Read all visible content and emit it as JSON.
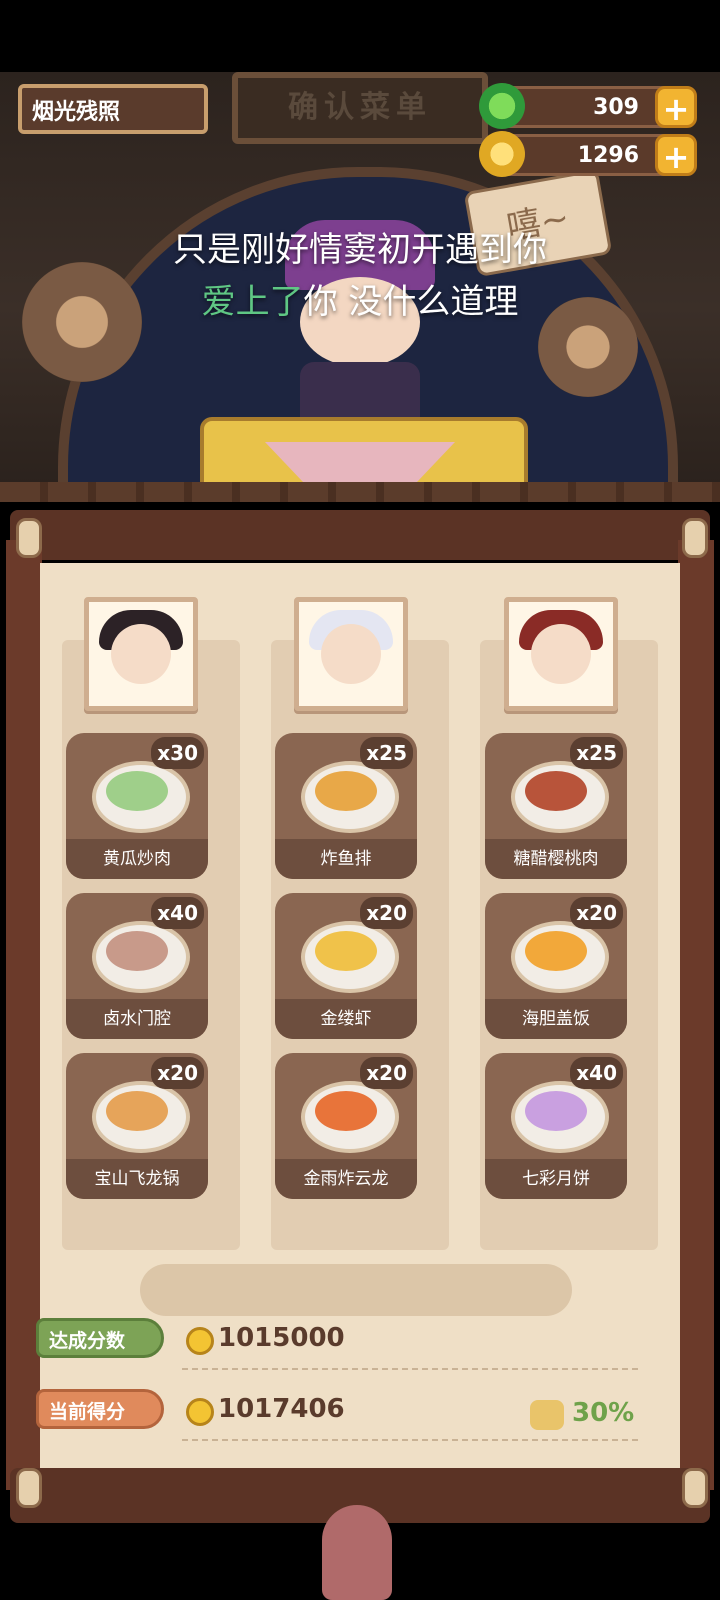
{
  "header": {
    "stage_name": "烟光残照",
    "signboard": "确认菜单",
    "jade": {
      "value": "309",
      "plus": "+"
    },
    "coins": {
      "value": "1296",
      "plus": "+"
    },
    "speech_text": "嘻~"
  },
  "lyrics": {
    "line1": "只是刚好情窦初开遇到你",
    "line2_highlight": "爱上了",
    "line2_rest": "你 没什么道理"
  },
  "customers": [
    {
      "name": "customer-1",
      "dishes": [
        {
          "name": "黄瓜炒肉",
          "qty": "x30",
          "color": "#9fcf8a"
        },
        {
          "name": "卤水门腔",
          "qty": "x40",
          "color": "#c89a8a"
        },
        {
          "name": "宝山飞龙锅",
          "qty": "x20",
          "color": "#e6a45a"
        }
      ]
    },
    {
      "name": "customer-2",
      "dishes": [
        {
          "name": "炸鱼排",
          "qty": "x25",
          "color": "#e8a848"
        },
        {
          "name": "金缕虾",
          "qty": "x20",
          "color": "#f0c24a"
        },
        {
          "name": "金雨炸云龙",
          "qty": "x20",
          "color": "#e8743a"
        }
      ]
    },
    {
      "name": "customer-3",
      "dishes": [
        {
          "name": "糖醋樱桃肉",
          "qty": "x25",
          "color": "#b8543a"
        },
        {
          "name": "海胆盖饭",
          "qty": "x20",
          "color": "#f2a83a"
        },
        {
          "name": "七彩月饼",
          "qty": "x40",
          "color": "#c9a0e0"
        }
      ]
    }
  ],
  "targets": {
    "target_label": "达成分数",
    "target_value": "1015000",
    "current_label": "当前得分",
    "current_value": "1017406",
    "bonus": "30%"
  }
}
